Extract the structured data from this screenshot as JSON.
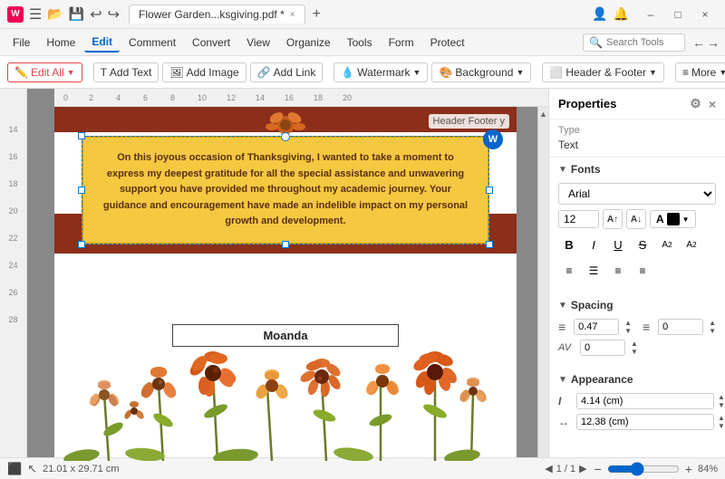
{
  "titleBar": {
    "appIcon": "W",
    "title": "Flower Garden...ksgiving.pdf *",
    "controls": [
      "–",
      "□",
      "×"
    ]
  },
  "menuBar": {
    "items": [
      "File",
      "Home",
      "Edit",
      "Comment",
      "Convert",
      "View",
      "Organize",
      "Tools",
      "Form",
      "Protect"
    ]
  },
  "searchTools": {
    "placeholder": "Search Tools"
  },
  "toolbar": {
    "editAll": "Edit All",
    "addText": "Add Text",
    "addImage": "Add Image",
    "addLink": "Add Link",
    "watermark": "Watermark",
    "background": "Background",
    "headerFooter": "Header & Footer",
    "more": "More"
  },
  "page": {
    "dimensions": "21.01 x 29.71 cm",
    "pageNum": "1",
    "pageTotal": "1"
  },
  "canvas": {
    "headerFooterLabel": "Header  Footer  y",
    "thankgivingText": "On this joyous occasion of Thanksgiving, I wanted to take a moment to express my deepest gratitude for all the special assistance and unwavering support you have provided me throughout my academic journey. Your guidance and encouragement have made an indelible impact on my personal growth and development.",
    "nameText": "Moanda"
  },
  "properties": {
    "title": "Properties",
    "type_label": "Type",
    "type_value": "Text",
    "fonts_section": "Fonts",
    "font_name": "Arial",
    "font_size": "12",
    "spacing_section": "Spacing",
    "line_spacing_label": "≡",
    "line_spacing_value": "0.47",
    "para_spacing_label": "≡",
    "para_spacing_value": "0",
    "char_spacing_label": "AV",
    "char_spacing_value": "0",
    "appearance_section": "Appearance",
    "height_label": "I",
    "height_value": "4.14 (cm)",
    "width_label": "↔",
    "width_value": "12.38 (cm)"
  },
  "statusBar": {
    "dimensions": "21.01 x 29.71 cm",
    "pageNum": "1 / 1",
    "zoom": "84%"
  }
}
